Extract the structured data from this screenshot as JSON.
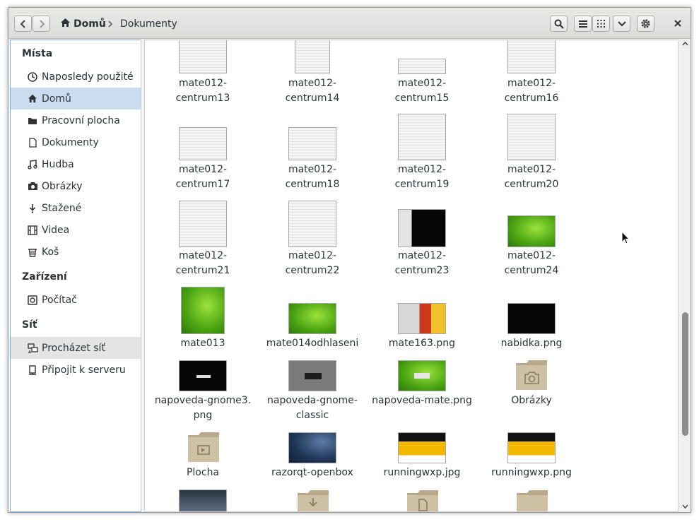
{
  "window": {
    "breadcrumb_home": "Domů",
    "breadcrumb_current": "Dokumenty"
  },
  "sidebar": {
    "heading_places": "Místa",
    "places": [
      {
        "label": "Naposledy použité",
        "icon": "clock-icon"
      },
      {
        "label": "Domů",
        "icon": "home-icon"
      },
      {
        "label": "Pracovní plocha",
        "icon": "folder-icon"
      },
      {
        "label": "Dokumenty",
        "icon": "document-icon"
      },
      {
        "label": "Hudba",
        "icon": "music-icon"
      },
      {
        "label": "Obrázky",
        "icon": "camera-icon"
      },
      {
        "label": "Stažené",
        "icon": "download-icon"
      },
      {
        "label": "Videa",
        "icon": "film-icon"
      },
      {
        "label": "Koš",
        "icon": "trash-icon"
      }
    ],
    "heading_devices": "Zařízení",
    "devices": [
      {
        "label": "Počítač",
        "icon": "computer-icon"
      }
    ],
    "heading_network": "Síť",
    "network": [
      {
        "label": "Procházet síť",
        "icon": "network-icon"
      },
      {
        "label": "Připojit k serveru",
        "icon": "server-icon"
      }
    ]
  },
  "files": [
    {
      "line1": "mate012-",
      "line2": "centrum13"
    },
    {
      "line1": "mate012-",
      "line2": "centrum14"
    },
    {
      "line1": "mate012-",
      "line2": "centrum15"
    },
    {
      "line1": "mate012-",
      "line2": "centrum16"
    },
    {
      "line1": "mate012-",
      "line2": "centrum17"
    },
    {
      "line1": "mate012-",
      "line2": "centrum18"
    },
    {
      "line1": "mate012-",
      "line2": "centrum19"
    },
    {
      "line1": "mate012-",
      "line2": "centrum20"
    },
    {
      "line1": "mate012-",
      "line2": "centrum21"
    },
    {
      "line1": "mate012-",
      "line2": "centrum22"
    },
    {
      "line1": "mate012-",
      "line2": "centrum23"
    },
    {
      "line1": "mate012-",
      "line2": "centrum24"
    },
    {
      "line1": "mate013",
      "line2": ""
    },
    {
      "line1": "mate014odhlaseni",
      "line2": ""
    },
    {
      "line1": "mate163.png",
      "line2": ""
    },
    {
      "line1": "nabidka.png",
      "line2": ""
    },
    {
      "line1": "napoveda-gnome3.",
      "line2": "png"
    },
    {
      "line1": "napoveda-gnome-",
      "line2": "classic"
    },
    {
      "line1": "napoveda-mate.png",
      "line2": ""
    },
    {
      "line1": "Obrázky",
      "line2": ""
    },
    {
      "line1": "Plocha",
      "line2": ""
    },
    {
      "line1": "razorqt-openbox",
      "line2": ""
    },
    {
      "line1": "runningwxp.jpg",
      "line2": ""
    },
    {
      "line1": "runningwxp.png",
      "line2": ""
    }
  ]
}
